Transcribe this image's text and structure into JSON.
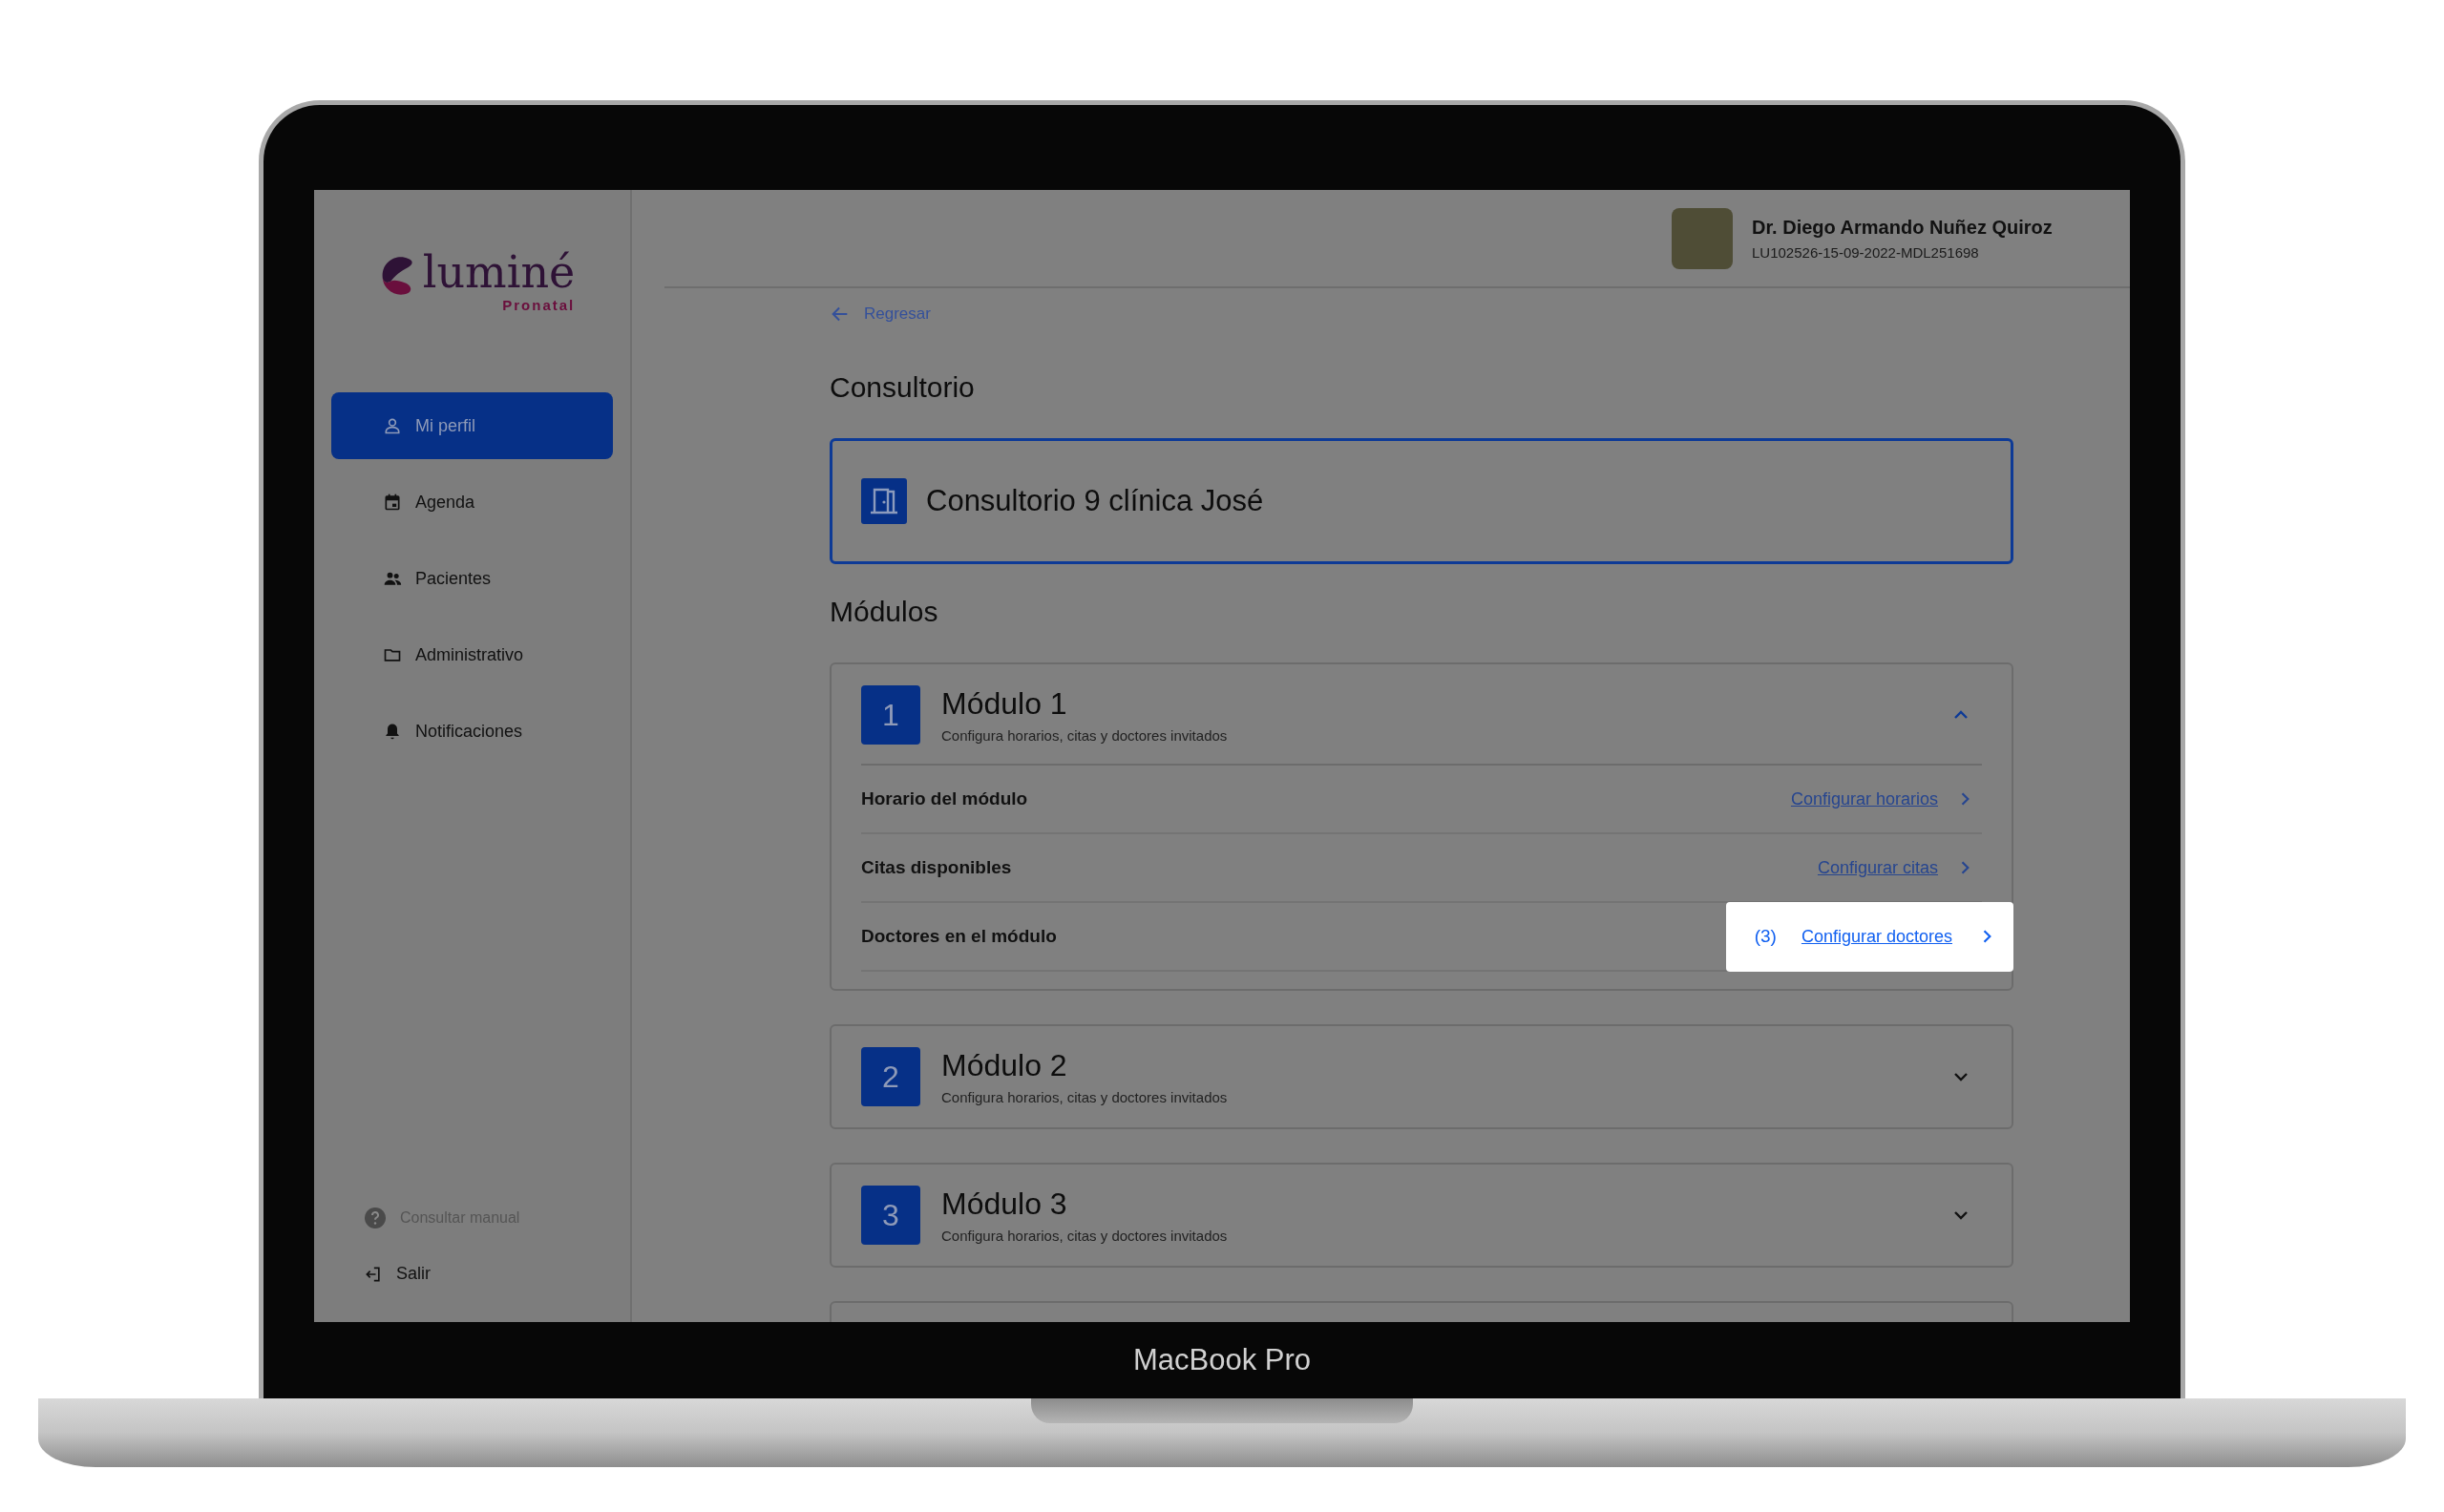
{
  "sidebar": {
    "logo": {
      "name": "luminé",
      "tagline": "Pronatal"
    },
    "items": [
      {
        "label": "Mi perfil",
        "selected": true
      },
      {
        "label": "Agenda",
        "selected": false
      },
      {
        "label": "Pacientes",
        "selected": false
      },
      {
        "label": "Administrativo",
        "selected": false
      },
      {
        "label": "Notificaciones",
        "selected": false
      }
    ],
    "help": "Consultar manual",
    "logout": "Salir"
  },
  "header": {
    "user_name": "Dr. Diego Armando Nuñez Quiroz",
    "user_id": "LU102526-15-09-2022-MDL251698"
  },
  "back_link": "Regresar",
  "office": {
    "heading": "Consultorio",
    "name": "Consultorio 9 clínica José"
  },
  "modules_heading": "Módulos",
  "modules": [
    {
      "number": "1",
      "title": "Módulo 1",
      "subtitle": "Configura horarios, citas y doctores invitados",
      "expanded": true,
      "rows": [
        {
          "label": "Horario del módulo",
          "link": "Configurar horarios",
          "highlighted": false
        },
        {
          "label": "Citas disponibles",
          "link": "Configurar citas",
          "highlighted": false
        },
        {
          "label": "Doctores en el módulo",
          "count": "(3)",
          "link": "Configurar doctores",
          "highlighted": true
        }
      ]
    },
    {
      "number": "2",
      "title": "Módulo 2",
      "subtitle": "Configura horarios, citas y doctores invitados",
      "expanded": false
    },
    {
      "number": "3",
      "title": "Módulo 3",
      "subtitle": "Configura horarios, citas y doctores invitados",
      "expanded": false
    }
  ],
  "device_label": "MacBook Pro"
}
